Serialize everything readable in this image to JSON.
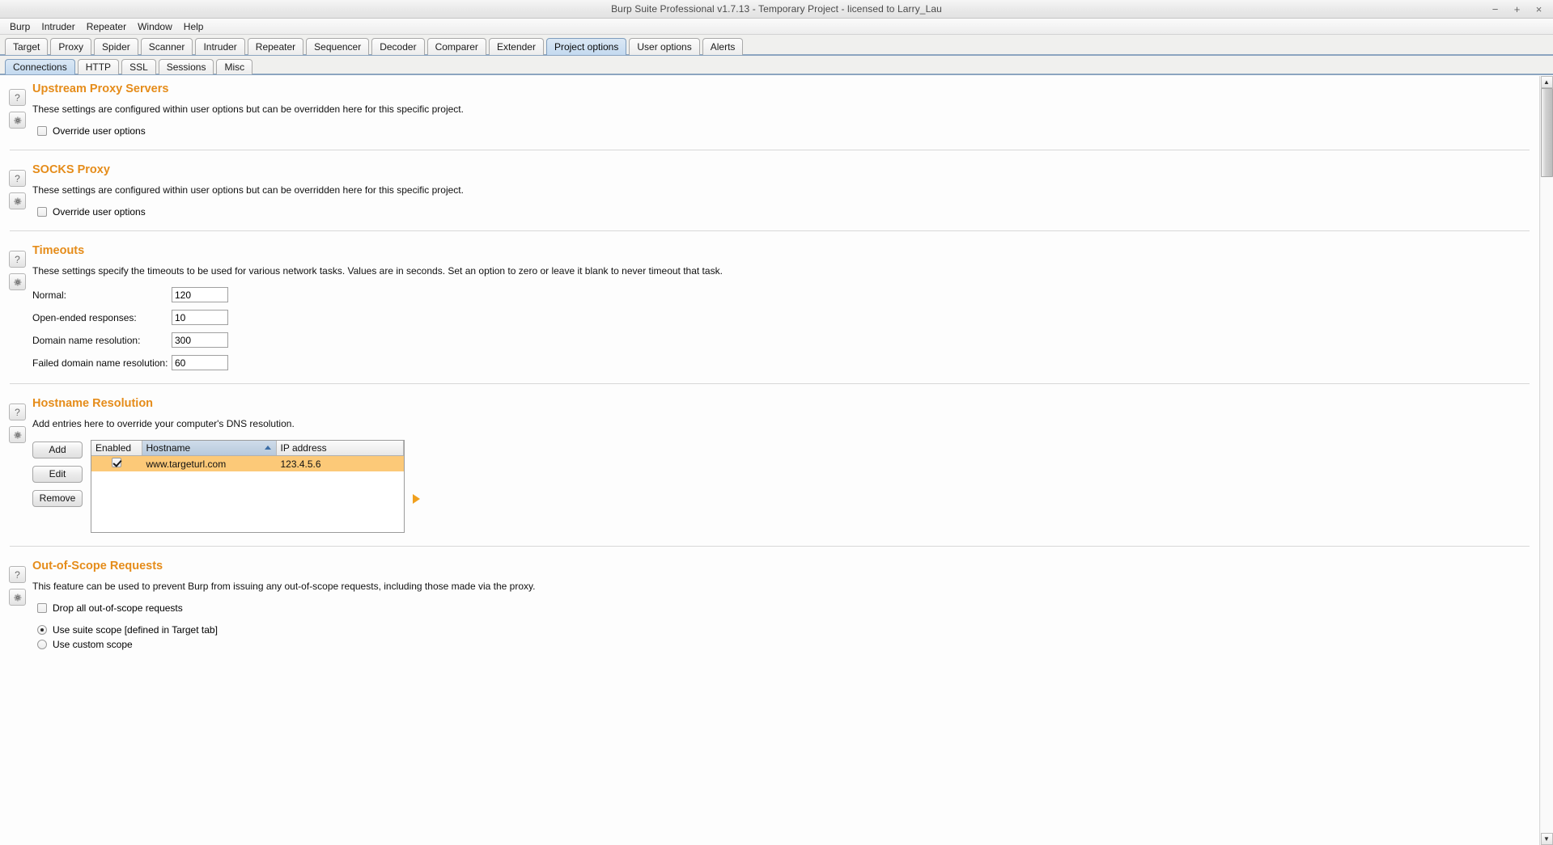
{
  "window": {
    "title": "Burp Suite Professional v1.7.13 - Temporary Project - licensed to Larry_Lau",
    "minimize": "−",
    "maximize": "+",
    "close": "×"
  },
  "menu": {
    "items": [
      {
        "label": "Burp"
      },
      {
        "label": "Intruder"
      },
      {
        "label": "Repeater"
      },
      {
        "label": "Window"
      },
      {
        "label": "Help"
      }
    ]
  },
  "tabs": {
    "active": "Project options",
    "items": [
      {
        "label": "Target"
      },
      {
        "label": "Proxy"
      },
      {
        "label": "Spider"
      },
      {
        "label": "Scanner"
      },
      {
        "label": "Intruder"
      },
      {
        "label": "Repeater"
      },
      {
        "label": "Sequencer"
      },
      {
        "label": "Decoder"
      },
      {
        "label": "Comparer"
      },
      {
        "label": "Extender"
      },
      {
        "label": "Project options"
      },
      {
        "label": "User options"
      },
      {
        "label": "Alerts"
      }
    ]
  },
  "subtabs": {
    "active": "Connections",
    "items": [
      {
        "label": "Connections"
      },
      {
        "label": "HTTP"
      },
      {
        "label": "SSL"
      },
      {
        "label": "Sessions"
      },
      {
        "label": "Misc"
      }
    ]
  },
  "icons": {
    "help": "?",
    "gear": "gear-icon"
  },
  "sections": {
    "upstream_proxy": {
      "title": "Upstream Proxy Servers",
      "description": "These settings are configured within user options but can be overridden here for this specific project.",
      "override_label": "Override user options",
      "override_checked": false
    },
    "socks_proxy": {
      "title": "SOCKS Proxy",
      "description": "These settings are configured within user options but can be overridden here for this specific project.",
      "override_label": "Override user options",
      "override_checked": false
    },
    "timeouts": {
      "title": "Timeouts",
      "description": "These settings specify the timeouts to be used for various network tasks. Values are in seconds. Set an option to zero or leave it blank to never timeout that task.",
      "fields": [
        {
          "label": "Normal:",
          "value": "120"
        },
        {
          "label": "Open-ended responses:",
          "value": "10"
        },
        {
          "label": "Domain name resolution:",
          "value": "300"
        },
        {
          "label": "Failed domain name resolution:",
          "value": "60"
        }
      ]
    },
    "hostname_resolution": {
      "title": "Hostname Resolution",
      "description": "Add entries here to override your computer's DNS resolution.",
      "buttons": [
        {
          "label": "Add"
        },
        {
          "label": "Edit"
        },
        {
          "label": "Remove"
        }
      ],
      "table": {
        "columns": [
          "Enabled",
          "Hostname",
          "IP address"
        ],
        "sorted_column": "Hostname",
        "sort_direction": "ascending",
        "rows": [
          {
            "enabled": true,
            "hostname": "www.targeturl.com",
            "ip_address": "123.4.5.6",
            "selected": true
          }
        ]
      }
    },
    "out_of_scope": {
      "title": "Out-of-Scope Requests",
      "description": "This feature can be used to prevent Burp from issuing any out-of-scope requests, including those made via the proxy.",
      "drop_label": "Drop all out-of-scope requests",
      "drop_checked": false,
      "scope_options": [
        {
          "label": "Use suite scope [defined in Target tab]",
          "selected": true
        },
        {
          "label": "Use custom scope",
          "selected": false
        }
      ]
    }
  },
  "colors": {
    "section_heading": "#e58c1a",
    "selected_row": "#fcc978",
    "active_tab": "#c3d9ef",
    "marker": "#f0a01e"
  },
  "scrollbar": {
    "up_arrow": "▲",
    "down_arrow": "▼"
  }
}
